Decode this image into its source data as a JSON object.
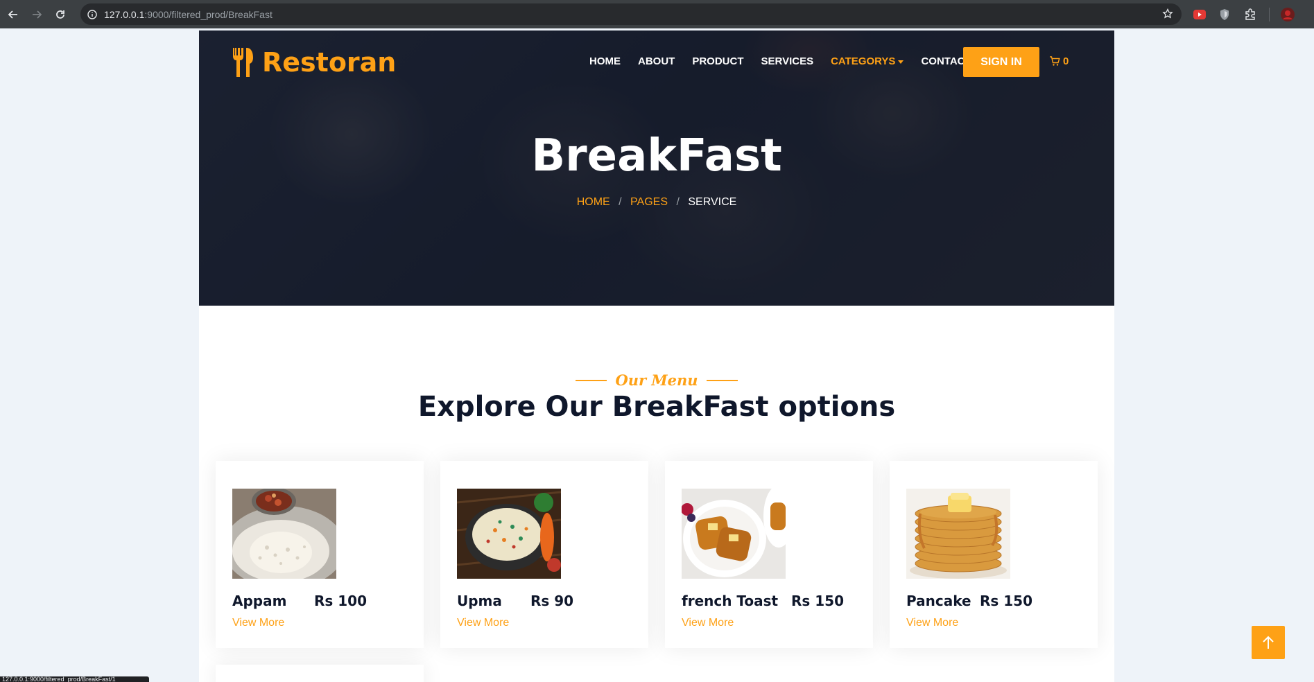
{
  "browser": {
    "url_host": "127.0.0.1",
    "url_path": ":9000/filtered_prod/BreakFast",
    "status_text": "127.0.0.1:9000/filtered_prod/BreakFast/1"
  },
  "brand": {
    "name": "Restoran"
  },
  "nav": {
    "items": [
      {
        "label": "HOME"
      },
      {
        "label": "ABOUT"
      },
      {
        "label": "PRODUCT"
      },
      {
        "label": "SERVICES"
      },
      {
        "label": "CATEGORYS"
      },
      {
        "label": "CONTACT"
      }
    ],
    "signin_label": "SIGN IN",
    "cart_count": "0"
  },
  "hero": {
    "title": "BreakFast",
    "breadcrumb": [
      "HOME",
      "PAGES",
      "SERVICE"
    ]
  },
  "menu_section": {
    "subtitle": "Our Menu",
    "title": "Explore Our BreakFast options"
  },
  "products": [
    {
      "name": "Appam",
      "price": "Rs 100",
      "link": "View More"
    },
    {
      "name": "Upma",
      "price": "Rs 90",
      "link": "View More"
    },
    {
      "name": "french Toast",
      "price": "Rs 150",
      "link": "View More"
    },
    {
      "name": "Pancake",
      "price": "Rs 150",
      "link": "View More"
    }
  ],
  "colors": {
    "accent": "#fea116",
    "dark": "#0f172b"
  }
}
